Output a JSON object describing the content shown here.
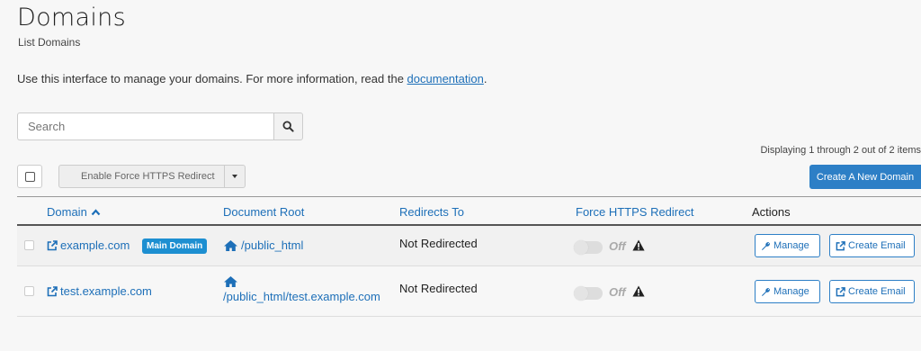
{
  "header": {
    "title": "Domains",
    "subtitle": "List Domains",
    "intro_text": "Use this interface to manage your domains. For more information, read the ",
    "intro_link": "documentation",
    "intro_end": "."
  },
  "search": {
    "placeholder": "Search",
    "value": "",
    "icon": "search-icon"
  },
  "pagination": {
    "text": "Displaying 1 through 2 out of 2 items"
  },
  "toolbar": {
    "bulk_action_label": "Enable Force HTTPS Redirect",
    "create_label": "Create A New Domain"
  },
  "table": {
    "columns": {
      "domain": "Domain",
      "document_root": "Document Root",
      "redirects_to": "Redirects To",
      "force_https": "Force HTTPS Redirect",
      "actions": "Actions"
    },
    "sort_icon": "chevron-up-icon",
    "rows": [
      {
        "domain": "example.com",
        "badge": "Main Domain",
        "document_root": "/public_html",
        "redirects_to": "Not Redirected",
        "force_https": "Off",
        "manage_label": "Manage",
        "email_label": "Create Email"
      },
      {
        "domain": "test.example.com",
        "badge": "",
        "document_root": "/public_html/test.example.com",
        "redirects_to": "Not Redirected",
        "force_https": "Off",
        "manage_label": "Manage",
        "email_label": "Create Email"
      }
    ]
  },
  "colors": {
    "link": "#1d6fb8",
    "primary_button": "#2d7fc6",
    "badge": "#1d8fd1",
    "background": "#f7f7f7"
  }
}
